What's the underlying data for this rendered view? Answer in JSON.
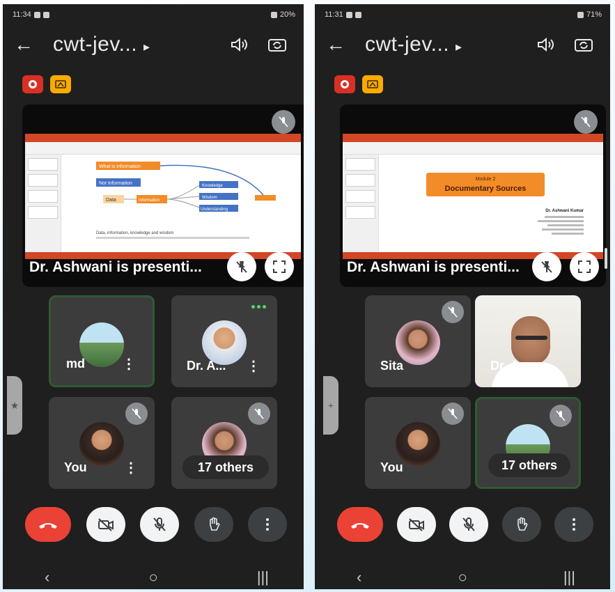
{
  "phones": [
    {
      "status_time": "11:34",
      "status_right": "20%",
      "meeting_title": "cwt-jev...",
      "presenter_caption": "Dr. Ashwani is presenti...",
      "slide": {
        "boxes": [
          "What is information",
          "Not Information",
          "Data",
          "Information",
          "Knowledge",
          "Wisdom",
          "Understanding"
        ],
        "footnote": "Data, information, knowledge and wisdom"
      },
      "tiles": [
        {
          "name": "md",
          "more": "⋮"
        },
        {
          "name": "Dr. A...",
          "more": "⋮"
        },
        {
          "name": "You",
          "more": "⋮"
        },
        {
          "name": "17 others"
        }
      ]
    },
    {
      "status_time": "11:31",
      "status_right": "71%",
      "meeting_title": "cwt-jev...",
      "presenter_caption": "Dr. Ashwani is presenti...",
      "slide": {
        "heading_small": "Module 2",
        "heading": "Documentary Sources",
        "author_name": "Dr. Ashwani Kumar"
      },
      "tiles": [
        {
          "name": "Sita"
        },
        {
          "name": "Dr. A..."
        },
        {
          "name": "You"
        },
        {
          "name": "17 others"
        }
      ]
    }
  ],
  "colors": {
    "end_call": "#ea4335",
    "record_badge": "#d93025",
    "share_badge": "#f9ab00",
    "active_border": "#2e5b34",
    "slide_accent": "#d24726",
    "slide_box_orange": "#f28c28",
    "slide_box_blue": "#4472c4"
  },
  "icons": {
    "back": "←",
    "title_arrow": "▸",
    "nav_back": "‹",
    "nav_home": "○",
    "nav_recents": "|||"
  }
}
